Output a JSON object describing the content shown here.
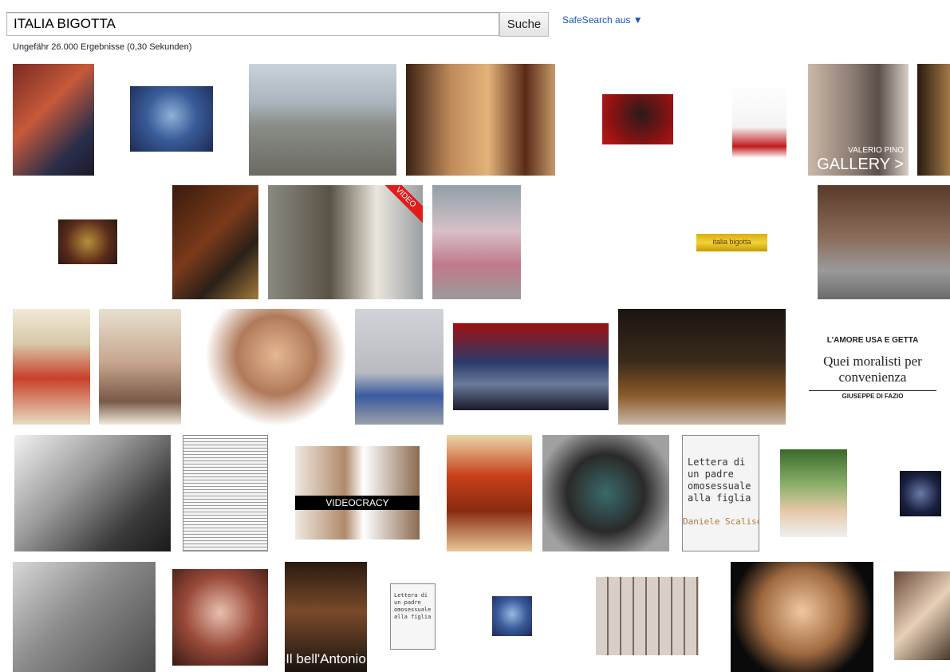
{
  "search": {
    "query": "ITALIA BIGOTTA",
    "button_label": "Suche",
    "safesearch_label": "SafeSearch aus ▼",
    "result_stats": "Ungefähr 26.000 Ergebnisse (0,30 Sekunden)"
  },
  "thumbnails": [
    {
      "name": "image-result-man-glasses-thumbs-up",
      "bg": "linear-gradient(135deg,#7a2a22,#c65a3a 40%,#2a2e4a 75%,#1a1a2a)"
    },
    {
      "name": "image-result-tv-show-stage",
      "bg": "radial-gradient(circle at 50% 45%,#8fb0d8,#3a5c9a 45%,#1c2a55)"
    },
    {
      "name": "image-result-man-on-beach",
      "bg": "linear-gradient(180deg,#c9d3dc 0%,#a9b4bd 35%,#8a8d88 55%,#6b6a62 100%)"
    },
    {
      "name": "image-result-tinto-brass-posters",
      "bg": "linear-gradient(90deg,#3a2214,#c08a5a 30%,#e3b37a 55%,#5a2a18 80%,#c79a6a)"
    },
    {
      "name": "image-result-man-red-chair",
      "bg": "radial-gradient(circle at 55% 40%,#2b1a1a,#8a1212 60%,#c01818)"
    },
    {
      "name": "image-result-event-flyer",
      "bg": "linear-gradient(180deg,#ffffff,#f4f4f4 60%,#c31c1c 85%,#ffffff)"
    },
    {
      "name": "image-result-valerio-pino-gallery",
      "bg": "linear-gradient(90deg,#cbb8a7,#8a7a70 45%,#5a4f4a 70%,#d9cfc6)",
      "caption": "VALERIO PINO",
      "caption2": "GALLERY >"
    },
    {
      "name": "image-result-edge-crop-1",
      "bg": "linear-gradient(90deg,#2a1a10,#a27a48)"
    },
    {
      "name": "image-result-tv-stage-small",
      "bg": "radial-gradient(circle at 50% 50%,#b8903a,#5a2a1a 60%,#2a1a14)"
    },
    {
      "name": "image-result-parliament-vote",
      "bg": "linear-gradient(135deg,#3a1a0e,#7a3a1a 45%,#2a2018 70%,#a37a3a)"
    },
    {
      "name": "image-result-video-interview",
      "bg": "linear-gradient(90deg,#8a8a80,#5a5246 40%,#ebe6dd 70%,#9aa0a4)",
      "badge": "VIDEO"
    },
    {
      "name": "image-result-vending-machine",
      "bg": "linear-gradient(180deg,#8fa0a8,#d8c0c8 40%,#c07a8a 70%,#9a9a9a)"
    },
    {
      "name": "image-result-rototom-sunsplash-logo",
      "bg": "#ffffff"
    },
    {
      "name": "image-result-italia-bigotta-banner",
      "bg": "linear-gradient(180deg,#d8b010,#f2d23a 50%,#c49a00)",
      "caption": "italia bigotta"
    },
    {
      "name": "image-result-man-bench-bicycle",
      "bg": "linear-gradient(180deg,#5a3a2a,#8a6a58 45%,#9a9a9a 75%,#6a6a6a)"
    },
    {
      "name": "image-result-il-bigamo-poster",
      "bg": "linear-gradient(180deg,#f2ead8,#d8c8a8 30%,#c8402a 60%,#e8dcc0)"
    },
    {
      "name": "image-result-campaign-poster",
      "bg": "linear-gradient(180deg,#e8e0d0,#c8a890 45%,#7a5a48 80%,#f0e8da)"
    },
    {
      "name": "image-result-man-portrait",
      "bg": "radial-gradient(circle at 50% 40%,#e6b894,#b07a5a 40%,#ffffff 72%)"
    },
    {
      "name": "image-result-cleaning-cart",
      "bg": "linear-gradient(180deg,#d0d4d8,#b8bcc0 55%,#3a5aa0 75%,#9aa0a8)"
    },
    {
      "name": "image-result-tv-talk-show",
      "bg": "linear-gradient(180deg,#a01010,#2a3a6a 45%,#6a7a9a 70%,#1a1a2a)"
    },
    {
      "name": "image-result-stage-ceremony",
      "bg": "linear-gradient(180deg,#1a1410,#3a2a1a 45%,#8a5a2a 75%,#c9b9a8)"
    },
    {
      "name": "image-result-moralisti-article",
      "bg": "#ffffff",
      "caption_top": "L'AMORE USA E GETTA",
      "caption": "Quei moralisti per convenienza",
      "caption2": "GIUSEPPE DI FAZIO"
    },
    {
      "name": "image-result-bw-embrace",
      "bg": "linear-gradient(135deg,#f2f2f2,#9a9a9a 40%,#3a3a3a 75%,#1a1a1a)"
    },
    {
      "name": "image-result-newspaper-page",
      "bg": "repeating-linear-gradient(180deg,#f5f5f5 0 3px,#9a9a9a 3px 4px)"
    },
    {
      "name": "image-result-videocracy-poster",
      "bg": "linear-gradient(90deg,#f0e8e0,#b08a6a 40%,#ffffff 55%,#8a6a50)",
      "caption": "VIDEOCRACY"
    },
    {
      "name": "image-result-divorzio-poster",
      "bg": "linear-gradient(180deg,#e8d8a8,#c8401a 35%,#8a2a10 65%,#e8c898)"
    },
    {
      "name": "image-result-woman-pose",
      "bg": "radial-gradient(circle at 50% 50%,#3a6a6a,#2a2a2a 45%,#a0a0a0 80%)"
    },
    {
      "name": "image-result-lettera-book-cover",
      "bg": "#f4f4f4",
      "caption": "Lettera di un padre omosessuale alla figlia",
      "caption2": "Daniele Scalise"
    },
    {
      "name": "image-result-bald-man",
      "bg": "linear-gradient(180deg,#3a6a2a,#8ab06a 40%,#e6c8a8 70%,#f0f0f0)"
    },
    {
      "name": "image-result-night-building",
      "bg": "radial-gradient(circle at 50% 50%,#6a7aa8,#1a2040 60%,#0a0e1a)"
    },
    {
      "name": "image-result-bw-man-face",
      "bg": "linear-gradient(135deg,#d8d8d8,#8a8a8a 45%,#4a4a4a)"
    },
    {
      "name": "image-result-woman-cigarette",
      "bg": "radial-gradient(circle at 50% 45%,#e8c0b0,#9a4a3a 50%,#3a1a14)"
    },
    {
      "name": "image-result-il-bellantonio-poster",
      "bg": "linear-gradient(180deg,#2a1a10,#7a4a2a 45%,#1a1410)",
      "caption": "Il bell'Antonio"
    },
    {
      "name": "image-result-lettera-book-small",
      "bg": "#f6f6f6",
      "caption": "Lettera di un padre omosessuale alla figlia"
    },
    {
      "name": "image-result-tv-stage-tiny",
      "bg": "radial-gradient(circle at 50% 45%,#9ab8e0,#3a5a9a 50%,#1a2a55)"
    },
    {
      "name": "image-result-face-grid",
      "bg": "repeating-linear-gradient(90deg,#d8d0c8 0 14px,#7a6a5a 14px 16px)"
    },
    {
      "name": "image-result-woman-smiling",
      "bg": "radial-gradient(circle at 50% 45%,#f0c8a0,#a06a40 45%,#0a0a0a 75%)"
    },
    {
      "name": "image-result-edge-crop-2",
      "bg": "linear-gradient(135deg,#6a4a3a,#e8d0b8 50%,#4a3a2a)"
    }
  ]
}
